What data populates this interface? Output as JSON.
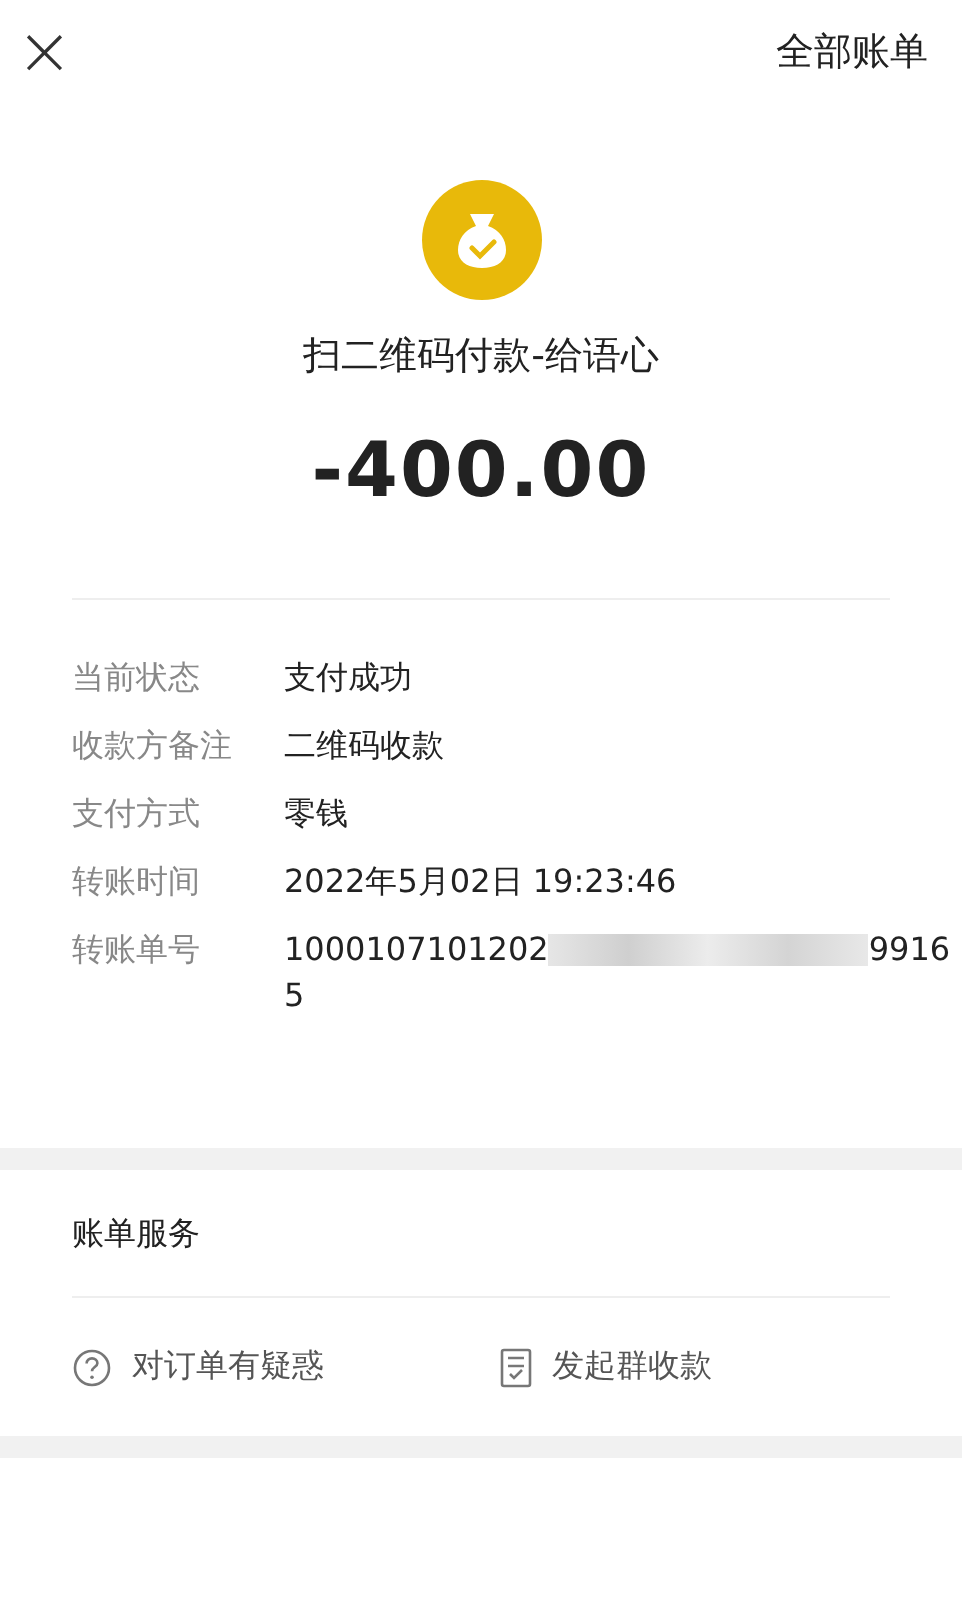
{
  "top_bar": {
    "close": "×",
    "link": "全部账单"
  },
  "payee": "扫二维码付款-给语心",
  "amount": "-400.00",
  "details": [
    {
      "label": "当前状态",
      "value": "支付成功"
    },
    {
      "label": "收款方备注",
      "value": "二维码收款"
    },
    {
      "label": "支付方式",
      "value": "零钱"
    },
    {
      "label": "转账时间",
      "value": "2022年5月02日 19:23:46"
    },
    {
      "label": "转账单号",
      "value": "1000107101202",
      "redacted": true,
      "value_end": "9916",
      "value_wrap": "5"
    }
  ],
  "service": {
    "title": "账单服务",
    "actions": [
      {
        "label": "对订单有疑惑",
        "kind": "question"
      },
      {
        "label": "发起群收款",
        "kind": "checklist"
      }
    ]
  }
}
